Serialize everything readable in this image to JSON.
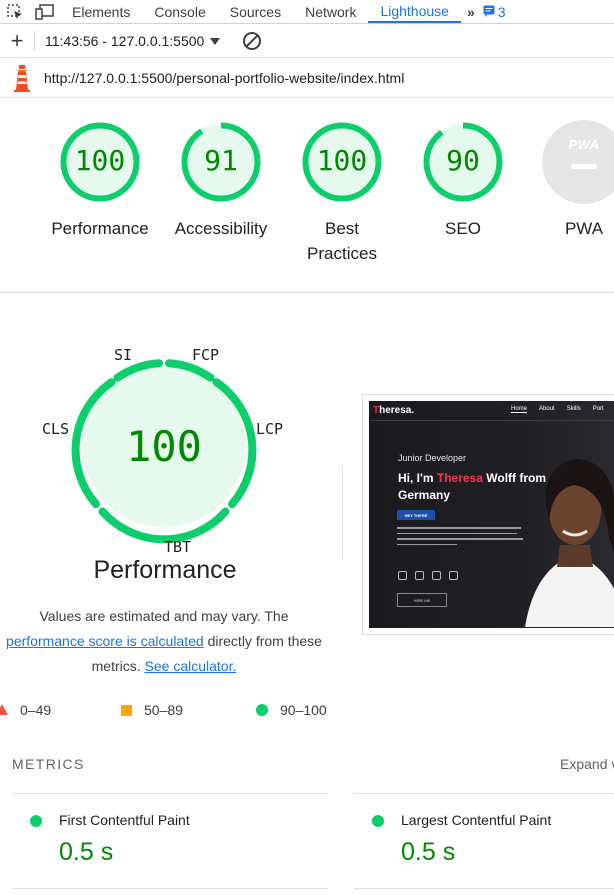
{
  "devtools": {
    "tabs": [
      {
        "label": "Elements"
      },
      {
        "label": "Console"
      },
      {
        "label": "Sources"
      },
      {
        "label": "Network"
      },
      {
        "label": "Lighthouse"
      }
    ],
    "more_label": "»",
    "issues_count": "3"
  },
  "toolbar": {
    "report_label": "11:43:56 - 127.0.0.1:5500"
  },
  "url": "http://127.0.0.1:5500/personal-portfolio-website/index.html",
  "categories": [
    {
      "score": "100",
      "label": "Performance",
      "fraction": 1.0
    },
    {
      "score": "91",
      "label": "Accessibility",
      "fraction": 0.91
    },
    {
      "score": "100",
      "label": "Best Practices",
      "fraction": 1.0
    },
    {
      "score": "90",
      "label": "SEO",
      "fraction": 0.9
    }
  ],
  "pwa": {
    "label": "PWA",
    "badge_text": "PWA"
  },
  "performance": {
    "score": "100",
    "title": "Performance",
    "metric_labels": {
      "si": "SI",
      "fcp": "FCP",
      "lcp": "LCP",
      "tbt": "TBT",
      "cls": "CLS"
    },
    "note_1": "Values are estimated and may vary. The",
    "note_link": "performance score is calculated",
    "note_2": "directly from these metrics.",
    "calc_link": "See calculator."
  },
  "legend": {
    "fail": "0–49",
    "average": "50–89",
    "pass": "90–100"
  },
  "colors": {
    "pass": "#0cce6b",
    "pass_text": "#008800",
    "average": "#ffa400",
    "fail": "#ff4e42",
    "accent": "#1a73e8"
  },
  "site_preview": {
    "logo_initial": "T",
    "logo_rest": "heresa.",
    "nav": [
      "Home",
      "About",
      "Skills",
      "Port"
    ],
    "role": "Junior Developer",
    "hi_1": "Hi, I'm",
    "name": "Theresa",
    "hi_2": "Wolff from Germany",
    "btn_hey": "HEY THERE",
    "btn_hire": "HIRE ME"
  },
  "metrics": {
    "heading": "METRICS",
    "expand": "Expand view",
    "items": [
      {
        "name": "First Contentful Paint",
        "value": "0.5 s"
      },
      {
        "name": "Largest Contentful Paint",
        "value": "0.5 s"
      }
    ]
  }
}
